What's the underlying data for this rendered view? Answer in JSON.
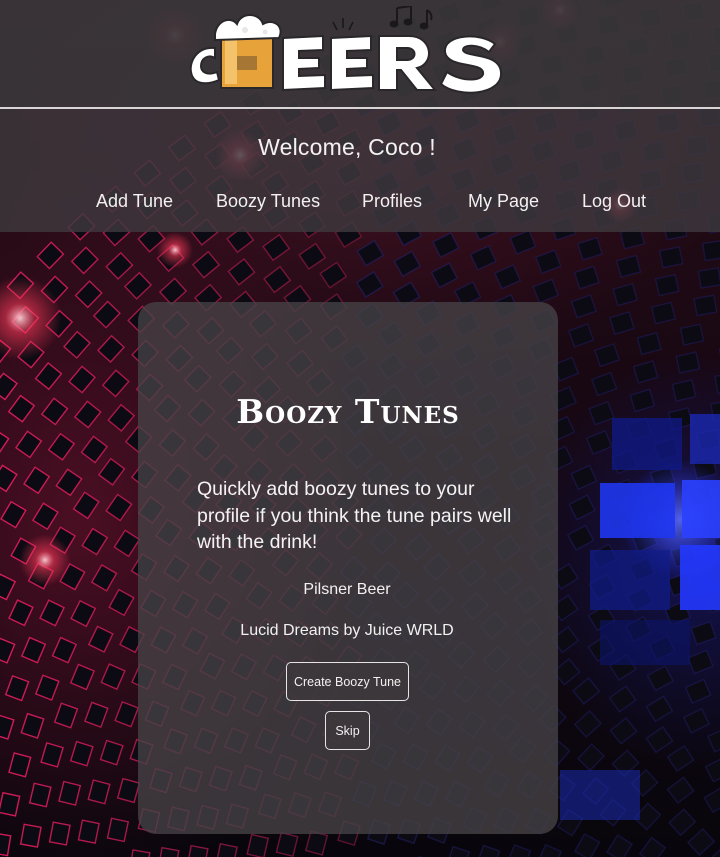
{
  "logo": {
    "text": "CHEERS",
    "icon": "beer-foam-icon",
    "accent_icon": "music-notes-icon"
  },
  "header": {
    "welcome": "Welcome, Coco !"
  },
  "nav": {
    "items": [
      {
        "label": "Add Tune"
      },
      {
        "label": "Boozy Tunes"
      },
      {
        "label": "Profiles"
      },
      {
        "label": "My Page"
      },
      {
        "label": "Log Out"
      }
    ]
  },
  "card": {
    "title": "Boozy Tunes",
    "description": "Quickly add boozy tunes to your profile if you think the tune pairs well with the drink!",
    "drink": "Pilsner Beer",
    "tune": "Lucid Dreams by Juice WRLD",
    "create_label": "Create Boozy Tune",
    "skip_label": "Skip"
  },
  "colors": {
    "header_bg": "#3a373a",
    "card_bg": "#46424a",
    "text": "#f3f0f1",
    "logo_beer": "#e8a23a",
    "background_red": "#c8203c",
    "background_blue": "#1a2ae0"
  }
}
